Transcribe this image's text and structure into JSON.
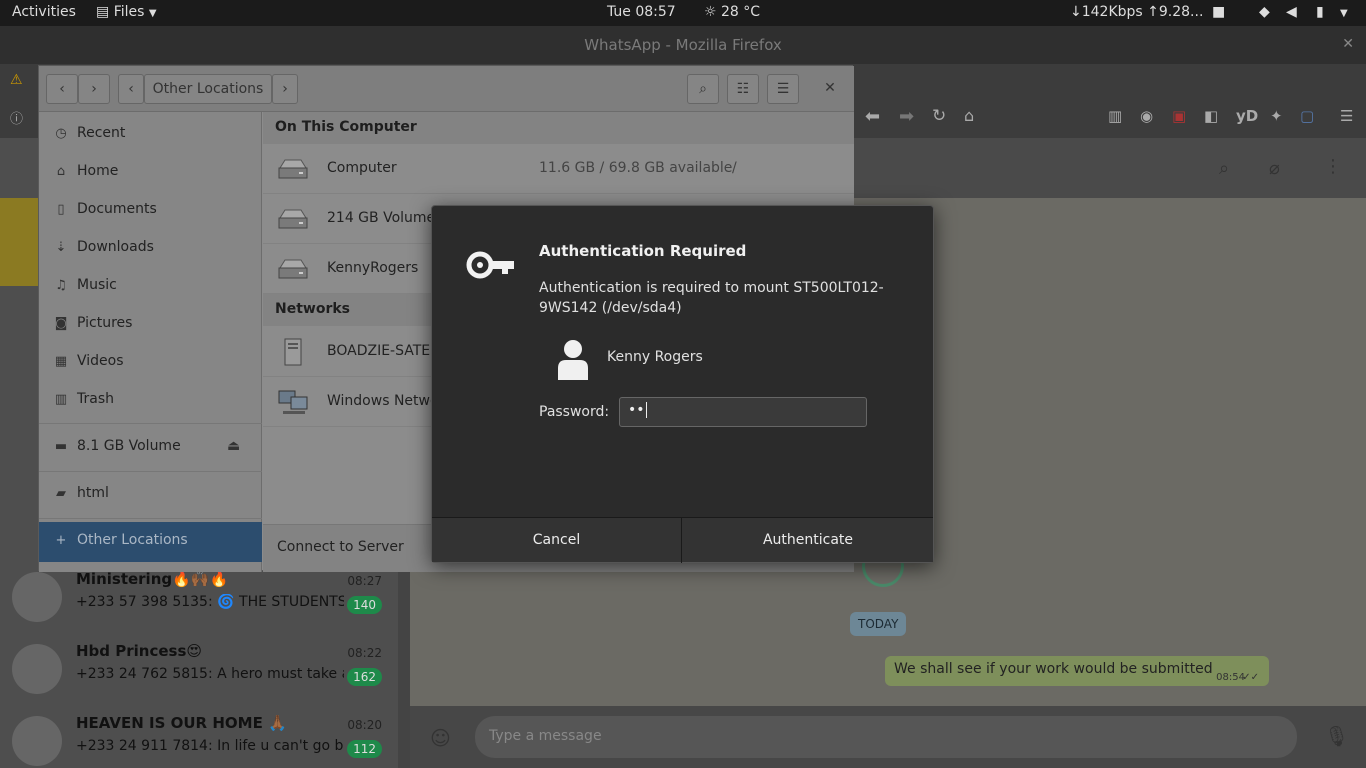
{
  "topbar": {
    "activities": "Activities",
    "app_menu": "Files",
    "clock": "Tue 08:57",
    "weather": "28 °C",
    "network_speed": "↓142Kbps ↑9.28..."
  },
  "firefox": {
    "title": "WhatsApp - Mozilla Firefox"
  },
  "whatsapp": {
    "chats": [
      {
        "name": "Ministering🔥🙌🏾🔥",
        "time": "08:27",
        "preview": "+233 57 398 5135: 🌀 THE STUDENTS'...",
        "unread": "140"
      },
      {
        "name": "Hbd Princess😍",
        "time": "08:22",
        "preview": "+233 24 762 5815: A hero must take a st...",
        "unread": "162"
      },
      {
        "name": "HEAVEN IS OUR HOME 🙏🏾",
        "time": "08:20",
        "preview": "+233 24 911 7814: In life u can't go back ...",
        "unread": "112"
      }
    ],
    "today_label": "TODAY",
    "bubble_text": "We shall see if your work would be submitted",
    "bubble_time": "08:54",
    "input_placeholder": "Type a message"
  },
  "files": {
    "path_label": "Other Locations",
    "sidebar": [
      {
        "label": "Recent",
        "icon": "clock-icon"
      },
      {
        "label": "Home",
        "icon": "home-icon"
      },
      {
        "label": "Documents",
        "icon": "document-icon"
      },
      {
        "label": "Downloads",
        "icon": "download-icon"
      },
      {
        "label": "Music",
        "icon": "music-icon"
      },
      {
        "label": "Pictures",
        "icon": "camera-icon"
      },
      {
        "label": "Videos",
        "icon": "film-icon"
      },
      {
        "label": "Trash",
        "icon": "trash-icon"
      }
    ],
    "sidebar_volume": "8.1 GB Volume",
    "sidebar_bookmark": "html",
    "sidebar_other": "Other Locations",
    "on_this_computer": "On This Computer",
    "locations": [
      {
        "name": "Computer",
        "info": "11.6 GB / 69.8 GB available",
        "path": "/"
      },
      {
        "name": "214 GB Volume",
        "info": "",
        "path": ""
      },
      {
        "name": "KennyRogers",
        "info": "",
        "path": ""
      }
    ],
    "networks_header": "Networks",
    "networks": [
      {
        "name": "BOADZIE-SATELLITE-S75-A"
      },
      {
        "name": "Windows Network"
      }
    ],
    "connect_label": "Connect to Server"
  },
  "auth": {
    "title": "Authentication Required",
    "message": "Authentication is required to mount ST500LT012-9WS142 (/dev/sda4)",
    "user": "Kenny Rogers",
    "password_label": "Password:",
    "password_value": "••",
    "cancel": "Cancel",
    "authenticate": "Authenticate"
  }
}
